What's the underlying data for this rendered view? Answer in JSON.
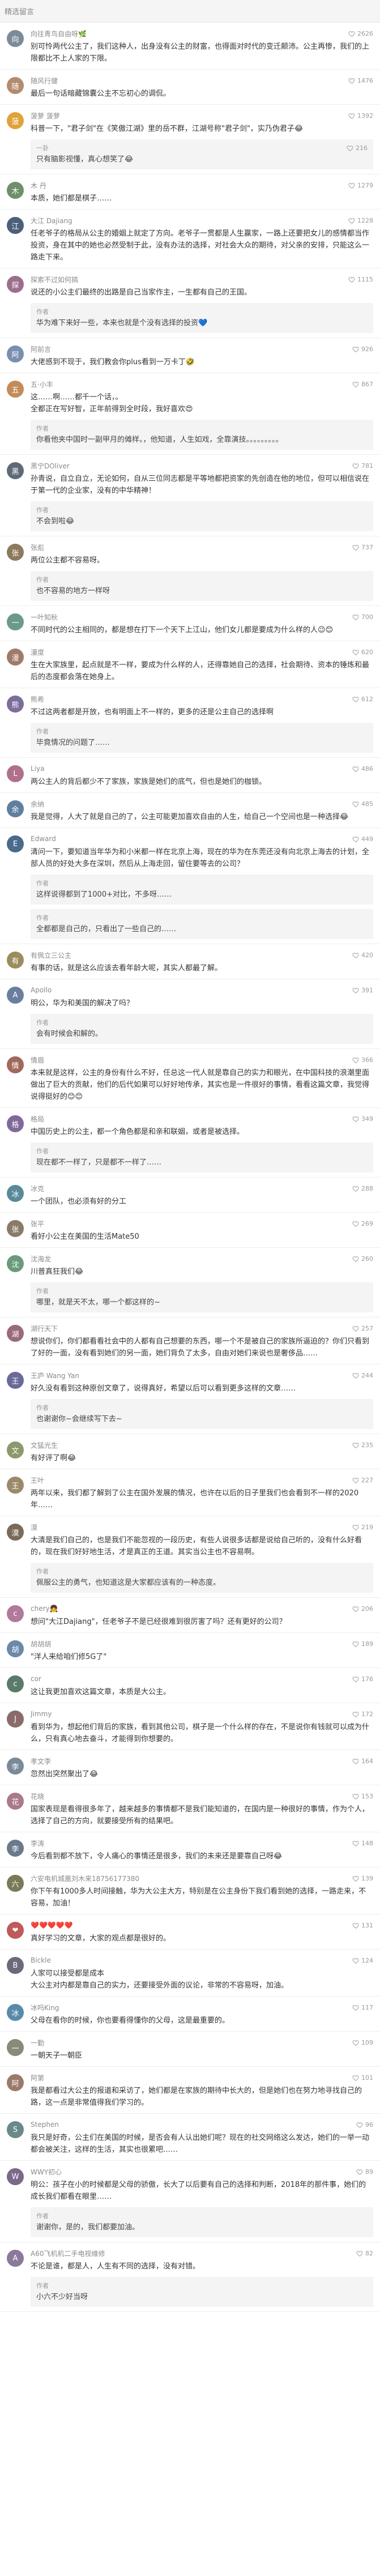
{
  "header": {
    "title": "精选留言"
  },
  "colors": {
    "header_bg": "#f5f5f5",
    "reply_bg": "#f4f4f4",
    "username": "#8a8a8a",
    "text": "#333333"
  },
  "comments": [
    {
      "user": "向往青鸟自由呀🌿",
      "likes": "2626",
      "avatar_color": "#7c8b9a",
      "avatar_char": "向",
      "text": "别可怜两代公主了，我们这种人，出身没有公主的财富，也得面对时代的变迁颠沛。公主再惨，我们的上限都比不上人家的下限。",
      "replies": []
    },
    {
      "user": "随风行健",
      "likes": "1476",
      "avatar_color": "#b38b6d",
      "avatar_char": "随",
      "text": "最后一句话暗藏锦囊公主不忘初心的调侃。",
      "replies": []
    },
    {
      "user": "菠萝 菠萝",
      "likes": "1392",
      "avatar_color": "#e0a23a",
      "avatar_char": "菠",
      "text": "科普一下，\"君子剑\"在《笑傲江湖》里的岳不群，江湖号称\"君子剑\"，实乃伪君子😂",
      "replies": [
        {
          "user": "一卦",
          "likes": "216",
          "text": "只有脑影视懂，真心想笑了😂"
        }
      ]
    },
    {
      "user": "木 丹",
      "likes": "1279",
      "avatar_color": "#6f8f6a",
      "avatar_char": "木",
      "text": "本质，她们都是棋子……",
      "replies": []
    },
    {
      "user": "大江 Dajiang",
      "likes": "1228",
      "avatar_color": "#4b5f7a",
      "avatar_char": "江",
      "text": "任老爷子的格局从公主的婚姻上就定了方向。老爷子一贯都是人生赢家，一路上还要把女儿的感情都当作投资，身在其中的她也必然受制于此，没有办法的选择，对社会大众的期待，对父亲的安排，只能这么一路走下来。",
      "replies": []
    },
    {
      "user": "探索不过如何搞",
      "likes": "1115",
      "avatar_color": "#9a6f8c",
      "avatar_char": "探",
      "text": "说还的小公主们最终的出路是自己当家作主，一生都有自己的王国。",
      "replies": [
        {
          "user": "作者",
          "likes": "",
          "text": "华为难下来好一些，本来也就是个没有选择的投资💙"
        }
      ]
    },
    {
      "user": "阿前言",
      "likes": "926",
      "avatar_color": "#7a8fb0",
      "avatar_char": "阿",
      "text": "大佬感到不现于，我们教会你plus看到一万卡丁🤣",
      "replies": []
    },
    {
      "user": "五·小丰",
      "likes": "867",
      "avatar_color": "#c48a5a",
      "avatar_char": "五",
      "text": "这……啊……都千一个话，。\n全都正在写好智，正年前得到全时段，我好喜欢😍",
      "replies": [
        {
          "user": "作者",
          "likes": "",
          "text": "你看他夹中国时一副甲月的傩样。，他知道，人生如戏，全靠演技。。。。。。。。。"
        }
      ]
    },
    {
      "user": "黑宁DOliver",
      "likes": "781",
      "avatar_color": "#5e6a78",
      "avatar_char": "黑",
      "text": "孙青说，自立自立，无论如何，自从三位同志都是平等地都把资家的先创造在他的地位，但可以相信说在于第一代的企业家，没有的中华精神！",
      "replies": [
        {
          "user": "作者",
          "likes": "",
          "text": "不会到啦😂"
        }
      ]
    },
    {
      "user": "张彪",
      "likes": "737",
      "avatar_color": "#8c7a5f",
      "avatar_char": "张",
      "text": "两位公主都不容易呀。",
      "replies": [
        {
          "user": "作者",
          "likes": "",
          "text": "也不容易的地方一样呀"
        }
      ]
    },
    {
      "user": "一叶知秋",
      "likes": "700",
      "avatar_color": "#6b9a8a",
      "avatar_char": "一",
      "text": "不同时代的公主相同的，都是想在打下一个天下上江山，他们女儿都是要成为什么样的人😉😊",
      "replies": []
    },
    {
      "user": "漫度",
      "likes": "620",
      "avatar_color": "#a07a6a",
      "avatar_char": "漫",
      "text": "生在大家族里，起点就是不一样，要成为什么样的人，还得靠她自己的选择，社会期待、资本的锤炼和最后的态度都会落在她身上。",
      "replies": []
    },
    {
      "user": "熊希",
      "likes": "612",
      "avatar_color": "#7b6d9c",
      "avatar_char": "熊",
      "text": "不过这两者都是开放，也有明面上不一样的，更多的还是公主自己的选择啊",
      "replies": [
        {
          "user": "作者",
          "likes": "",
          "text": "毕竟情况的问题了……"
        }
      ]
    },
    {
      "user": "Liya",
      "likes": "486",
      "avatar_color": "#b0708a",
      "avatar_char": "L",
      "text": "两公主人的背后都少不了家族，家族是她们的底气，但也是她们的枷锁。",
      "replies": []
    },
    {
      "user": "余纳",
      "likes": "485",
      "avatar_color": "#5f7f9f",
      "avatar_char": "余",
      "text": "我是觉得，人大了就是自己的了，公主可能更加喜欢自由的人生，给自己一个空间也是一种选择😂",
      "replies": []
    },
    {
      "user": "Edward",
      "likes": "449",
      "avatar_color": "#4a6b8a",
      "avatar_char": "E",
      "text": "清问一下，要知道当年华为和小米都一样在北京上海，现在的华为在东莞还没有向北京上海去的计划，全部人员的好处大多在深圳，然后从上海走回，留住要等去的公司？",
      "replies": [
        {
          "user": "作者",
          "likes": "",
          "text": "这样说得都到了1000+对比，不多呀……"
        },
        {
          "user": "作者",
          "likes": "",
          "text": "全都都是自己的，只看出了一些自己的……"
        }
      ]
    },
    {
      "user": "有佩立三公主",
      "likes": "420",
      "avatar_color": "#9c8c5c",
      "avatar_char": "有",
      "text": "有事的话，就是这么应该去看年龄大呢，其实人都最了解。",
      "replies": []
    },
    {
      "user": "Apollo",
      "likes": "391",
      "avatar_color": "#6a7fa0",
      "avatar_char": "A",
      "text": "明公，华为和美国的解决了吗？",
      "replies": [
        {
          "user": "作者",
          "likes": "",
          "text": "会有时候会和解的。"
        }
      ]
    },
    {
      "user": "情眉",
      "likes": "366",
      "avatar_color": "#a06a5a",
      "avatar_char": "情",
      "text": "本来就是这样，公主的身份有什么不好，任总这一代人就是靠自己的实力和眼光，在中国科技的浪潮里面做出了巨大的贡献，他们的后代如果可以好好地传承，其实也是一件很好的事情，看看这篇文章，我觉得说得挺好的😊😊",
      "replies": []
    },
    {
      "user": "格局",
      "likes": "349",
      "avatar_color": "#7f6a9a",
      "avatar_char": "格",
      "text": "中国历史上的公主，都一个角色都是和亲和联姻，或者是被选择。",
      "replies": [
        {
          "user": "作者",
          "likes": "",
          "text": "现在都不一样了，只是都不一样了……"
        }
      ]
    },
    {
      "user": "冰克",
      "likes": "288",
      "avatar_color": "#5a8a9a",
      "avatar_char": "冰",
      "text": "一个团队，也必须有好的分工",
      "replies": []
    },
    {
      "user": "张平",
      "likes": "269",
      "avatar_color": "#8a7a6a",
      "avatar_char": "张",
      "text": "看好小公主在美国的生活Mate50",
      "replies": []
    },
    {
      "user": "沈海龙",
      "likes": "260",
      "avatar_color": "#6a9a7a",
      "avatar_char": "沈",
      "text": "川普真狂我们😂",
      "replies": [
        {
          "user": "作者",
          "likes": "",
          "text": "哪里，就是天不太，哪一个都这样的~"
        }
      ]
    },
    {
      "user": "湖行天下",
      "likes": "257",
      "avatar_color": "#9a6a7a",
      "avatar_char": "湖",
      "text": "想说你们，你们都看看社会中的人都有自己想要的东西，哪一个不是被自己的家族所逼迫的？你们只看到了好的一面，没有看到她们的另一面，她们背负了太多，自由对她们来说也是奢侈品……",
      "replies": []
    },
    {
      "user": "王庐 Wang Yan",
      "likes": "244",
      "avatar_color": "#6a6a9a",
      "avatar_char": "王",
      "text": "好久没有看到这种原创文章了，说得真好，希望以后可以看到更多这样的文章……",
      "replies": [
        {
          "user": "作者",
          "likes": "",
          "text": "也谢谢你~会继续写下去~"
        }
      ]
    },
    {
      "user": "文猛光生",
      "likes": "235",
      "avatar_color": "#8a9a6a",
      "avatar_char": "文",
      "text": "有好评了啊😂",
      "replies": []
    },
    {
      "user": "王叶",
      "likes": "227",
      "avatar_color": "#9a8a6a",
      "avatar_char": "王",
      "text": "两年以来，我们都了解到了公主在国外发展的情况，也许在以后的日子里我们也会看到不一样的2020年……",
      "replies": []
    },
    {
      "user": "漠",
      "likes": "219",
      "avatar_color": "#7a6a5a",
      "avatar_char": "漠",
      "text": "大清是我们自己的，也是我们不能忽视的一段历史，有些人说很多话都是说给自己听的，没有什么好看的，现在我们好好地生活，才是真正的王道。其实当公主也不容易啊。",
      "replies": [
        {
          "user": "作者",
          "likes": "",
          "text": "佩服公主的勇气，也知道这是大家都应该有的一种态度。"
        }
      ]
    },
    {
      "user": "chery👧",
      "likes": "206",
      "avatar_color": "#b07a9a",
      "avatar_char": "c",
      "text": "想问\"大江Dajiang\"，任老爷子不是已经很难到很厉害了吗？还有更好的公司？",
      "replies": []
    },
    {
      "user": "胡胡胡",
      "likes": "189",
      "avatar_color": "#6a8aaa",
      "avatar_char": "胡",
      "text": "\"洋人来给咱们修5G了\"",
      "replies": []
    },
    {
      "user": "cor",
      "likes": "176",
      "avatar_color": "#5a7a6a",
      "avatar_char": "c",
      "text": "这让我更加喜欢这篇文章，本质是大公主。",
      "replies": []
    },
    {
      "user": "Jimmy",
      "likes": "172",
      "avatar_color": "#8a6a6a",
      "avatar_char": "J",
      "text": "看到华为，想起他们背后的家族，看到其他公司，棋子是一个什么样的存在，不是说你有钱就可以成为什么，只有真心地去奋斗，才能得到你想要的。",
      "replies": []
    },
    {
      "user": "孝文李",
      "likes": "164",
      "avatar_color": "#7a8a9a",
      "avatar_char": "李",
      "text": "忽然出突然聚出了😂",
      "replies": []
    },
    {
      "user": "花晓",
      "likes": "153",
      "avatar_color": "#aa7a8a",
      "avatar_char": "花",
      "text": "国家表现是看得很多年了，越来越多的事情都不是我们能知道的，在国内是一种很好的事情，作为个人，选择了自己的方向，就要接受所有的结果吧。",
      "replies": []
    },
    {
      "user": "李涛",
      "likes": "148",
      "avatar_color": "#6a7a8a",
      "avatar_char": "李",
      "text": "今后看到都不放下，令人痛心的事情还是很多，我们的未来还是要靠自己呀😂",
      "replies": []
    },
    {
      "user": "六安电机城凰刘木来18756177380",
      "likes": "139",
      "avatar_color": "#7a7a5a",
      "avatar_char": "六",
      "text": "你下午有1000多人时间接触，华为大公主大方，特别是在公主身份下我们看到她的选择，一路走来，不容易，加油！",
      "replies": []
    },
    {
      "user": "❤️❤️❤️❤️❤️",
      "likes": "131",
      "avatar_color": "#c05a5a",
      "avatar_char": "❤",
      "text": "真好学习的文章，大家的观点都是很好的。",
      "replies": []
    },
    {
      "user": "Bickle",
      "likes": "124",
      "avatar_color": "#6a6a7a",
      "avatar_char": "B",
      "text": "人家可以接受都是成本\n大公主对内都是靠自己的实力，还要接受外面的议论，非常的不容易呀，加油。",
      "replies": []
    },
    {
      "user": "冰吗King",
      "likes": "117",
      "avatar_color": "#5a8aaa",
      "avatar_char": "冰",
      "text": "父母在看你的时候，你也要看得懂你的父母，这是最重要的。",
      "replies": []
    },
    {
      "user": "一勤",
      "likes": "109",
      "avatar_color": "#8a8a7a",
      "avatar_char": "一",
      "text": "一朝天子一朝臣",
      "replies": []
    },
    {
      "user": "阿第",
      "likes": "101",
      "avatar_color": "#9a7a6a",
      "avatar_char": "阿",
      "text": "我是都看过大公主的报道和采访了，她们都是在家族的期待中长大的，但是她们也在努力地寻找自己的路，这一点是非常值得我们学习的。",
      "replies": []
    },
    {
      "user": "Stephen",
      "likes": "96",
      "avatar_color": "#6a8a8a",
      "avatar_char": "S",
      "text": "我只是好奇，公主们在美国的时候，是否会有人认出她们呢？现在的社交网络这么发达，她们的一举一动都会被关注，这样的生活，其实也很累吧……",
      "replies": []
    },
    {
      "user": "WWY初心",
      "likes": "89",
      "avatar_color": "#7a6a8a",
      "avatar_char": "W",
      "text": "明公：孩子在小的时候都是父母的骄傲，长大了以后要有自己的选择和判断，2018年的那件事，她们的成长我们都看在眼里……",
      "replies": [
        {
          "user": "作者",
          "likes": "",
          "text": "谢谢你，是的，我们都要加油。"
        }
      ]
    },
    {
      "user": "A60飞机机二手电视维修",
      "likes": "82",
      "avatar_color": "#8a7a9a",
      "avatar_char": "A",
      "text": "不论是谁，都是人，人生有不同的选择，没有对错。",
      "replies": [
        {
          "user": "作者",
          "likes": "",
          "text": "小六不少好当呀"
        }
      ]
    }
  ]
}
